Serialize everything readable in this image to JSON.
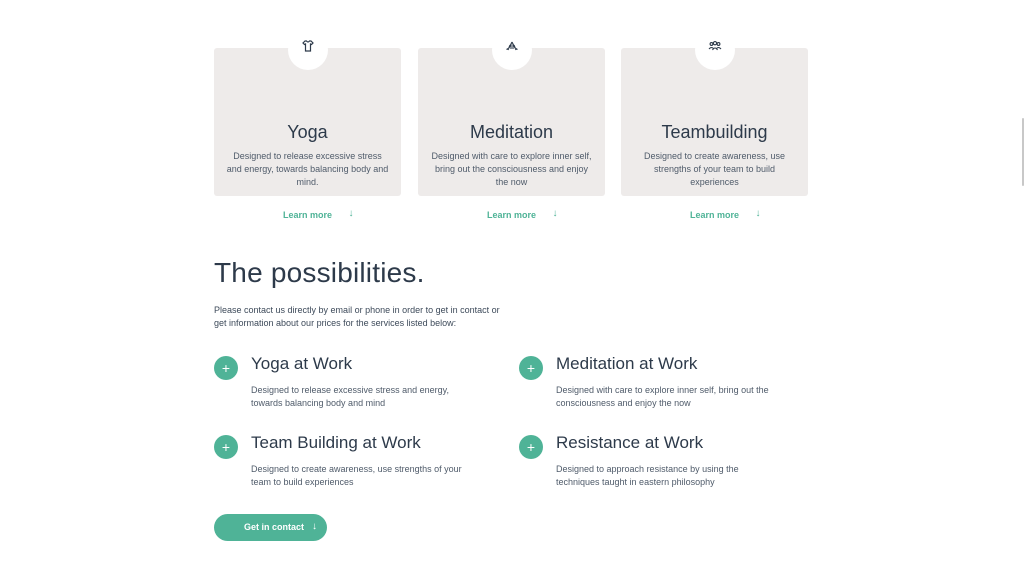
{
  "cards": [
    {
      "title": "Yoga",
      "description": "Designed to release excessive stress and energy, towards balancing body and mind.",
      "button": "Learn more",
      "icon": "yoga-shirt-icon"
    },
    {
      "title": "Meditation",
      "description": "Designed with care to explore inner self, bring out the consciousness and enjoy the now",
      "button": "Learn more",
      "icon": "meditation-hands-icon"
    },
    {
      "title": "Teambuilding",
      "description": "Designed to create awareness, use strengths of your team to build experiences",
      "button": "Learn more",
      "icon": "team-people-icon"
    }
  ],
  "possibilities": {
    "title": "The possibilities.",
    "intro": "Please contact us directly by email or phone in order to get in contact or get information about our prices for the services listed below:",
    "services": [
      {
        "title": "Yoga at Work",
        "description": "Designed to release excessive stress and energy, towards balancing body and mind"
      },
      {
        "title": "Meditation at Work",
        "description": "Designed with care to explore inner self, bring out the consciousness and enjoy the now"
      },
      {
        "title": "Team Building at Work",
        "description": "Designed to create awareness, use strengths of your team to build experiences"
      },
      {
        "title": "Resistance at Work",
        "description": "Designed to approach resistance by using the techniques taught in eastern philosophy"
      }
    ],
    "contact_button": "Get in contact"
  },
  "icons": {
    "arrow": "↓",
    "plus": "+"
  },
  "colors": {
    "accent": "#4fb397",
    "card_bg": "#eeebea",
    "text": "#2d3a4a"
  }
}
